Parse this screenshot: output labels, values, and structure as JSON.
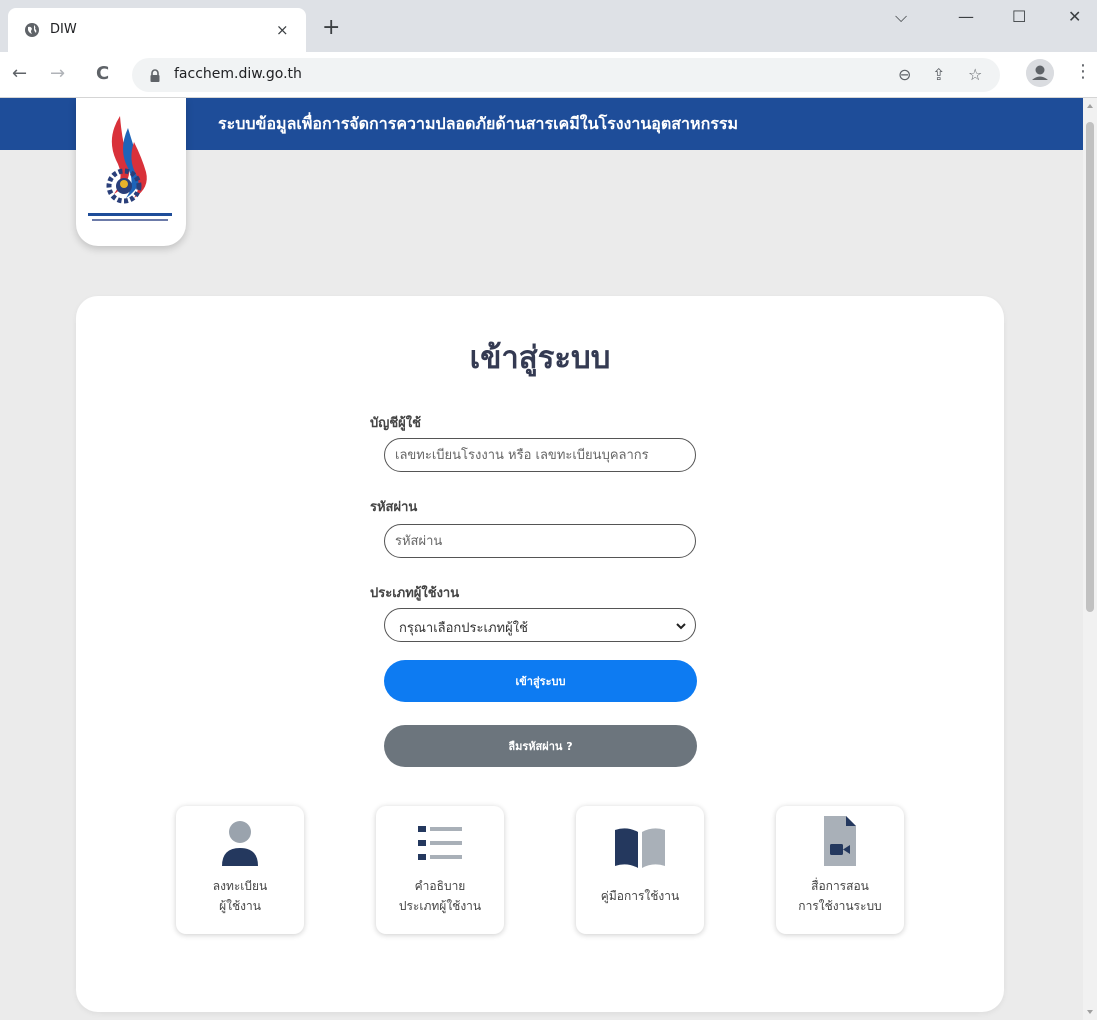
{
  "browser": {
    "tab_title": "DIW",
    "tab_close": "×",
    "new_tab": "+",
    "url": "facchem.diw.go.th",
    "window_controls": {
      "dropdown": "⌵",
      "minimize": "—",
      "maximize": "☐",
      "close": "✕"
    },
    "nav": {
      "back": "←",
      "forward": "→",
      "reload": "C"
    },
    "omnibox_icons": {
      "zoom": "⊖",
      "share": "⇪",
      "bookmark": "☆"
    },
    "menu": "⋮"
  },
  "header": {
    "title": "ระบบข้อมูลเพื่อการจัดการความปลอดภัยด้านสารเคมีในโรงงานอุตสาหกรรม",
    "band_color": "#1e4d99"
  },
  "login": {
    "title": "เข้าสู่ระบบ",
    "username_label": "บัญชีผู้ใช้",
    "username_placeholder": "เลขทะเบียนโรงงาน หรือ เลขทะเบียนบุคลากร",
    "password_label": "รหัสผ่าน",
    "password_placeholder": "รหัสผ่าน",
    "user_type_label": "ประเภทผู้ใช้งาน",
    "user_type_value": "กรุณาเลือกประเภทผู้ใช้",
    "login_button": "เข้าสู่ระบบ",
    "forgot_button": "ลืมรหัสผ่าน ?",
    "primary_color": "#0d7bf2",
    "secondary_color": "#6c757d"
  },
  "tiles": [
    {
      "line1": "ลงทะเบียน",
      "line2": "ผู้ใช้งาน",
      "icon": "user-icon"
    },
    {
      "line1": "คำอธิบาย",
      "line2": "ประเภทผู้ใช้งาน",
      "icon": "list-icon"
    },
    {
      "line1": "คู่มือการใช้งาน",
      "line2": "",
      "icon": "book-icon"
    },
    {
      "line1": "สื่อการสอน",
      "line2": "การใช้งานระบบ",
      "icon": "video-file-icon"
    }
  ]
}
